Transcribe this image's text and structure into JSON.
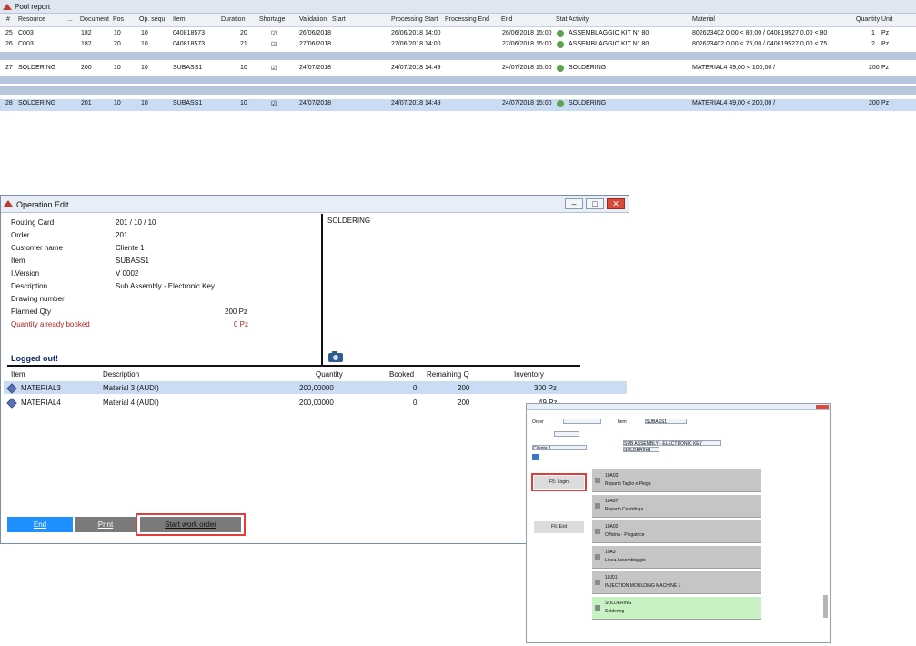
{
  "pool": {
    "title": "Pool report",
    "columns": [
      "#",
      "Resource",
      "...",
      "Document",
      "Pos",
      "Op. sequ.",
      "Item",
      "Duration",
      "Shortage",
      "Validation",
      "Start",
      "Processing Start",
      "Processing End",
      "End",
      "Stat",
      "Activity",
      "Material",
      "Quantity",
      "Unit"
    ],
    "rows": [
      {
        "n": "25",
        "resource": "C003",
        "doc": "182",
        "pos": "10",
        "seq": "10",
        "item": "040818573",
        "duration": "20",
        "shortage": "☑",
        "validation": "26/06/2018",
        "start": "26/06/2018 14:00",
        "pstart": "26/06/2018 14:00",
        "pend": "26/06/2018 15:00",
        "end": "26/06/2018 15:00",
        "activity": "ASSEMBLAGGIO KIT N° 80",
        "material": "802623402 0,00 < 80,00 / 040819527 0,00 < 80",
        "qty": "1",
        "unit": "Pz"
      },
      {
        "n": "26",
        "resource": "C003",
        "doc": "182",
        "pos": "20",
        "seq": "10",
        "item": "040818573",
        "duration": "21",
        "shortage": "☑",
        "validation": "27/06/2018",
        "start": "27/06/2018 14:00",
        "pstart": "27/06/2018 14:00",
        "pend": "27/06/2018 15:00",
        "end": "27/06/2018 15:00",
        "activity": "ASSEMBLAGGIO KIT N° 80",
        "material": "802623402 0,00 < 75,00 / 040819527 0,00 < 75",
        "qty": "2",
        "unit": "Pz"
      },
      {
        "n": "27",
        "resource": "SOLDERING",
        "doc": "200",
        "pos": "10",
        "seq": "10",
        "item": "SUBASS1",
        "duration": "10",
        "shortage": "☑",
        "validation": "24/07/2018",
        "start": "24/07/2018 14:49",
        "pstart": "24/07/2018 14:49",
        "pend": "24/07/2018 15:00",
        "end": "24/07/2018 15:00",
        "activity": "SOLDERING",
        "material": "MATERIAL4 49,00 < 100,00 /",
        "qty": "200",
        "unit": "Pz"
      },
      {
        "n": "28",
        "resource": "SOLDERING",
        "doc": "201",
        "pos": "10",
        "seq": "10",
        "item": "SUBASS1",
        "duration": "10",
        "shortage": "☑",
        "validation": "24/07/2018",
        "start": "24/07/2018 14:49",
        "pstart": "24/07/2018 14:49",
        "pend": "24/07/2018 15:00",
        "end": "24/07/2018 15:00",
        "activity": "SOLDERING",
        "material": "MATERIAL4 49,00 < 200,00 /",
        "qty": "200",
        "unit": "Pz"
      }
    ]
  },
  "op": {
    "title": "Operation Edit",
    "fields": [
      {
        "label": "Routing Card",
        "value": "201 / 10 / 10"
      },
      {
        "label": "Order",
        "value": "201"
      },
      {
        "label": "Customer name",
        "value": "Cliente 1"
      },
      {
        "label": "Item",
        "value": "SUBASS1"
      },
      {
        "label": "I.Version",
        "value": "V 0002"
      },
      {
        "label": "Description",
        "value": "Sub Assembly - Electronic Key"
      },
      {
        "label": "Drawing number",
        "value": ""
      }
    ],
    "planned_label": "Planned Qty",
    "planned_value": "200 Pz",
    "booked_label": "Quantity already booked",
    "booked_value": "0 Pz",
    "logged": "Logged out!",
    "note": "SOLDERING",
    "item_headers": [
      "Item",
      "Description",
      "Quantity",
      "Booked",
      "Remaining Q",
      "Inventory"
    ],
    "items": [
      {
        "item": "MATERIAL3",
        "desc": "Material 3 (AUDI)",
        "qty": "200,00000",
        "booked": "0",
        "rem": "200",
        "inv": "300 Pz"
      },
      {
        "item": "MATERIAL4",
        "desc": "Material 4 (AUDI)",
        "qty": "200,00000",
        "booked": "0",
        "rem": "200",
        "inv": "49 Pz"
      }
    ],
    "btn_end": "End",
    "btn_print": "Print",
    "btn_start": "Start work order",
    "win_min": "–",
    "win_max": "□",
    "win_close": "✕"
  },
  "small": {
    "fields": [
      "Order",
      "Item",
      "SUBASS1",
      "Customer",
      "Cliente 1",
      "Routing Card",
      "SUB ASSEMBLY - ELECTRONIC KEY",
      "Resource",
      "SOLDERING",
      "Planned Qty",
      "Booked Qty"
    ],
    "btn_login": "F5: Login",
    "btn_exit": "F6: Exit",
    "tiles": [
      {
        "code": "10A03",
        "name": "Reparto Taglio e Piega"
      },
      {
        "code": "10A07",
        "name": "Reparto Centrifuga"
      },
      {
        "code": "10A02",
        "name": "Officina - Piegatrice"
      },
      {
        "code": "10A3",
        "name": "Linea Assemblaggio"
      },
      {
        "code": "10J01",
        "name": "INJECTION MOULDING MACHINE 1"
      },
      {
        "code": "SOLDERING",
        "name": "Soldering"
      }
    ]
  },
  "colors": {
    "accent_blue": "#1e90ff",
    "selected_row": "#c9dcf4",
    "band": "#b6c7dd",
    "green_tile": "#c9f2c4",
    "red_outline": "#e53b3b"
  }
}
